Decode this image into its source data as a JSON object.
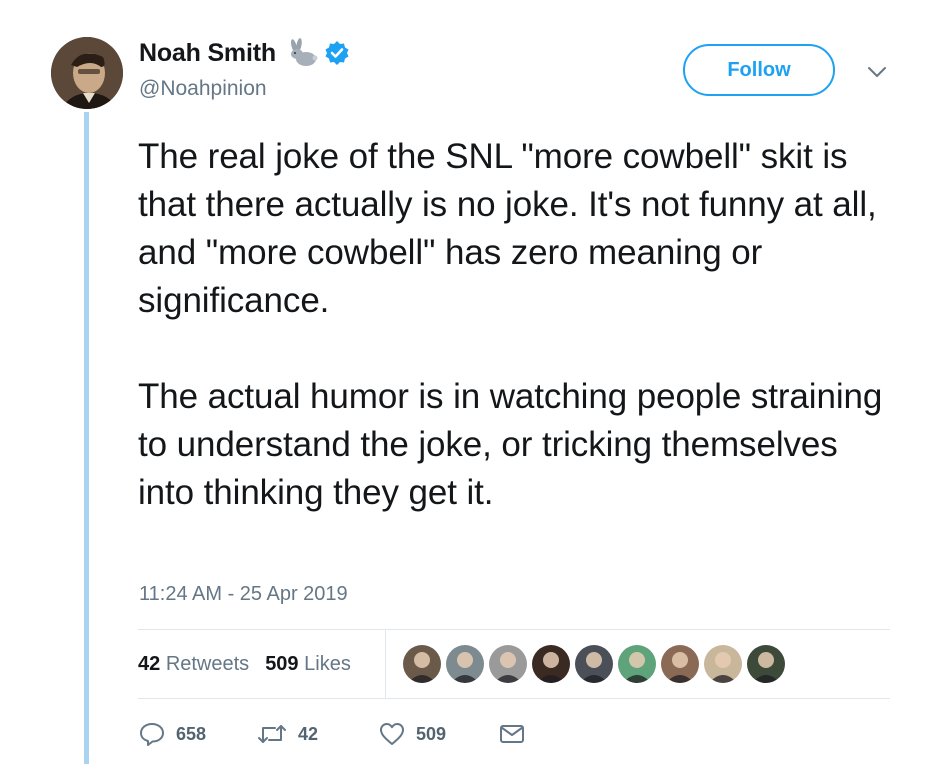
{
  "author": {
    "name": "Noah Smith",
    "handle": "@Noahpinion",
    "name_emoji": "rabbit-icon",
    "verified_badge": "verified-badge-icon",
    "avatar": "avatar-photo"
  },
  "follow_label": "Follow",
  "more_menu_icon": "chevron-down-icon",
  "tweet": {
    "paragraphs": [
      "The real joke of the SNL \"more cowbell\" skit is that there actually is no joke. It's not funny at all, and \"more cowbell\" has zero meaning or significance.",
      "The actual humor is in watching people straining to understand the joke, or tricking themselves into thinking they get it."
    ],
    "timestamp": "11:24 AM - 25 Apr 2019"
  },
  "stats": {
    "retweets_count": "42",
    "retweets_label": "Retweets",
    "likes_count": "509",
    "likes_label": "Likes"
  },
  "likers": [
    {
      "icon": "liker-avatar",
      "color": "#6b5a4a"
    },
    {
      "icon": "liker-avatar",
      "color": "#7d8a8f"
    },
    {
      "icon": "liker-avatar",
      "color": "#9a9a9a"
    },
    {
      "icon": "liker-avatar",
      "color": "#3b2a22"
    },
    {
      "icon": "liker-avatar",
      "color": "#4a4f58"
    },
    {
      "icon": "liker-avatar",
      "color": "#5fa37a"
    },
    {
      "icon": "liker-avatar",
      "color": "#8a6a55"
    },
    {
      "icon": "liker-avatar",
      "color": "#c9b79c"
    },
    {
      "icon": "liker-avatar",
      "color": "#3d4a3a"
    }
  ],
  "actions": {
    "reply_icon": "reply-icon",
    "reply_count": "658",
    "retweet_icon": "retweet-icon",
    "retweet_count": "42",
    "like_icon": "heart-icon",
    "like_count": "509",
    "dm_icon": "envelope-icon"
  },
  "colors": {
    "accent": "#1da1f2",
    "thread_line": "#a8d4f2",
    "muted_text": "#657786",
    "divider": "#e1e8ed"
  }
}
